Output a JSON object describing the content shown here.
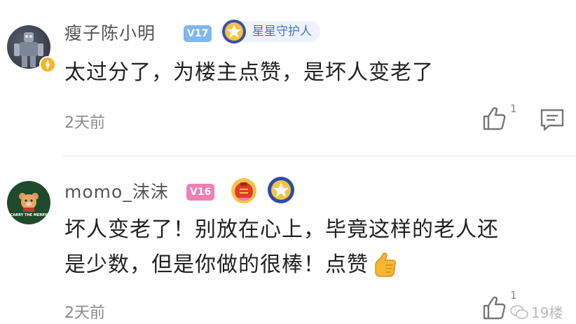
{
  "comments": [
    {
      "username": "瘦子陈小明",
      "level": "V17",
      "level_color": "#7fb7ee",
      "badges": [
        "星星守护人"
      ],
      "text": "太过分了，为楼主点赞，是坏人变老了",
      "time": "2天前",
      "likes": "1",
      "avatar_icon": "robot-avatar-icon"
    },
    {
      "username": "momo_沫沫",
      "level": "V16",
      "level_color": "#f07fb6",
      "badges": [
        "lantern-medal",
        "star-medal"
      ],
      "text_line1": "坏人变老了！别放在心上，毕竟这样的老人还",
      "text_line2": "是少数，但是你做的很棒！点赞",
      "time": "2天前",
      "likes": "1",
      "avatar_text": "CARRY THE MERRY"
    }
  ],
  "watermark": {
    "text": "19楼"
  }
}
